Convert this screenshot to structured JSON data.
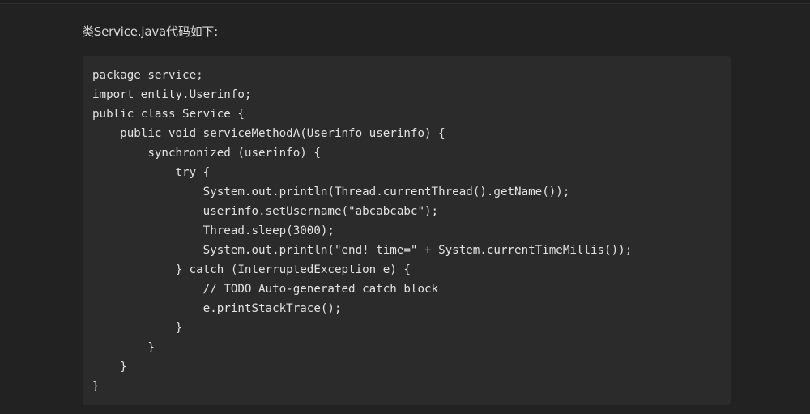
{
  "intro_text": "类Service.java代码如下:",
  "code": {
    "lines": [
      "package service;",
      "import entity.Userinfo;",
      "public class Service {",
      "    public void serviceMethodA(Userinfo userinfo) {",
      "        synchronized (userinfo) {",
      "            try {",
      "                System.out.println(Thread.currentThread().getName());",
      "                userinfo.setUsername(\"abcabcabc\");",
      "                Thread.sleep(3000);",
      "                System.out.println(\"end! time=\" + System.currentTimeMillis());",
      "            } catch (InterruptedException e) {",
      "                // TODO Auto-generated catch block",
      "                e.printStackTrace();",
      "            }",
      "        }",
      "    }",
      "}"
    ]
  }
}
